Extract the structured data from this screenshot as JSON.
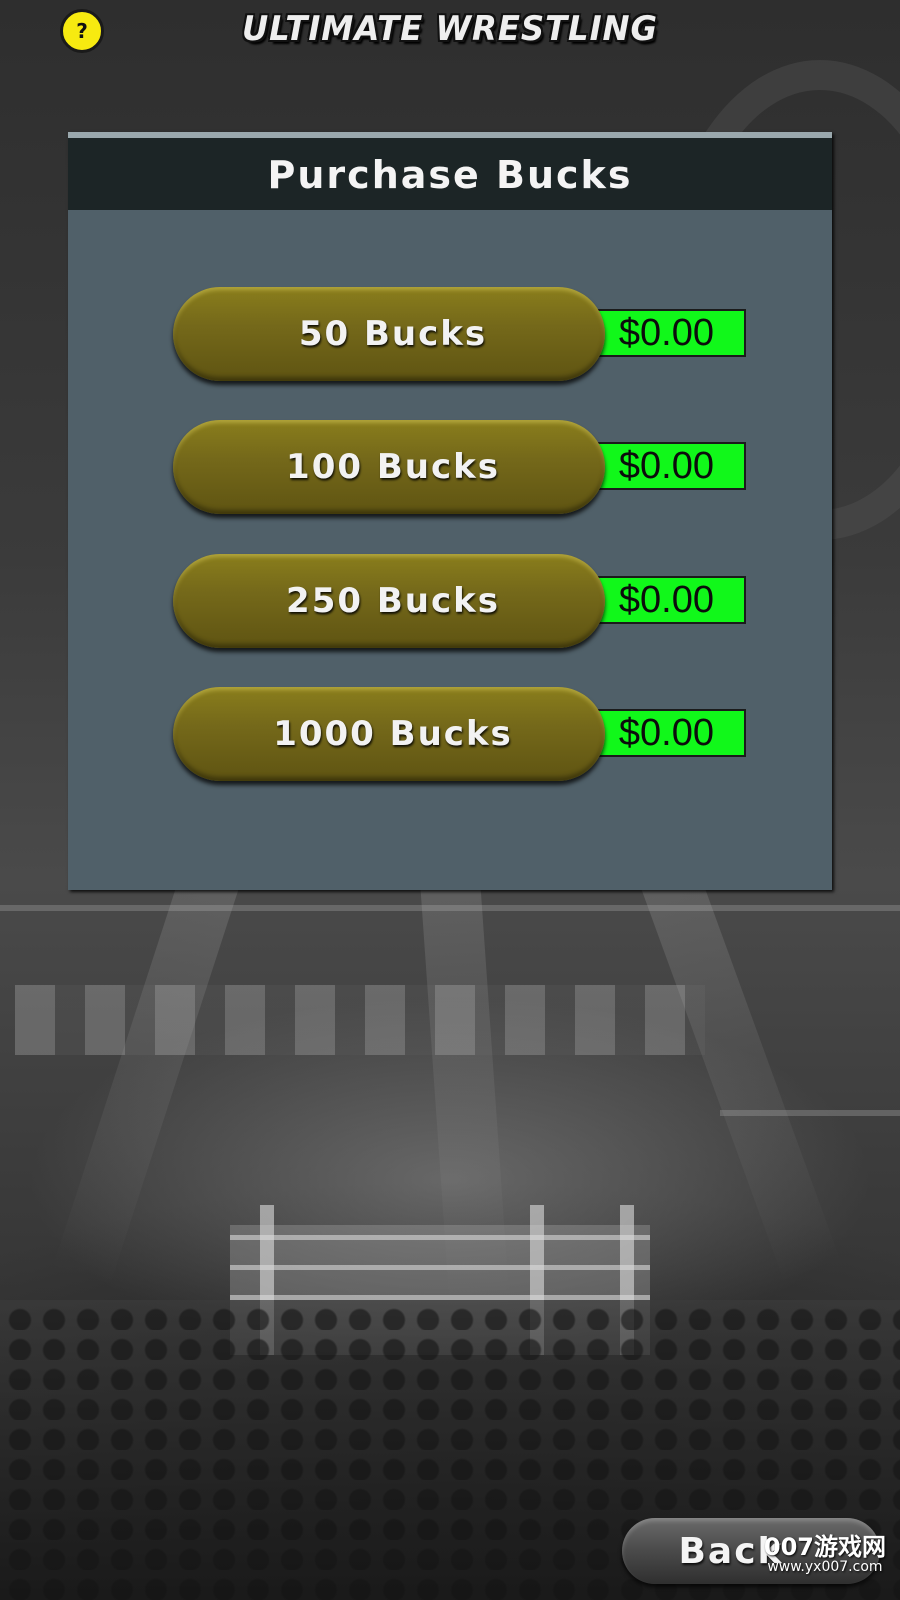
{
  "header": {
    "help_icon": "question-mark-icon",
    "help_label": "?",
    "game_title": "ULTIMATE WRESTLING"
  },
  "panel": {
    "title": "Purchase Bucks",
    "offers": [
      {
        "label": "50 Bucks",
        "price": "$0.00"
      },
      {
        "label": "100 Bucks",
        "price": "$0.00"
      },
      {
        "label": "250 Bucks",
        "price": "$0.00"
      },
      {
        "label": "1000 Bucks",
        "price": "$0.00"
      }
    ]
  },
  "footer": {
    "back_label": "Back"
  },
  "watermark": {
    "main": "007游戏网",
    "url": "www.yx007.com"
  },
  "colors": {
    "help_yellow": "#f7ea10",
    "panel_bg": "#506069",
    "panel_header_bg": "#1c2526",
    "offer_button": "#75691a",
    "price_green": "#11f81a"
  }
}
